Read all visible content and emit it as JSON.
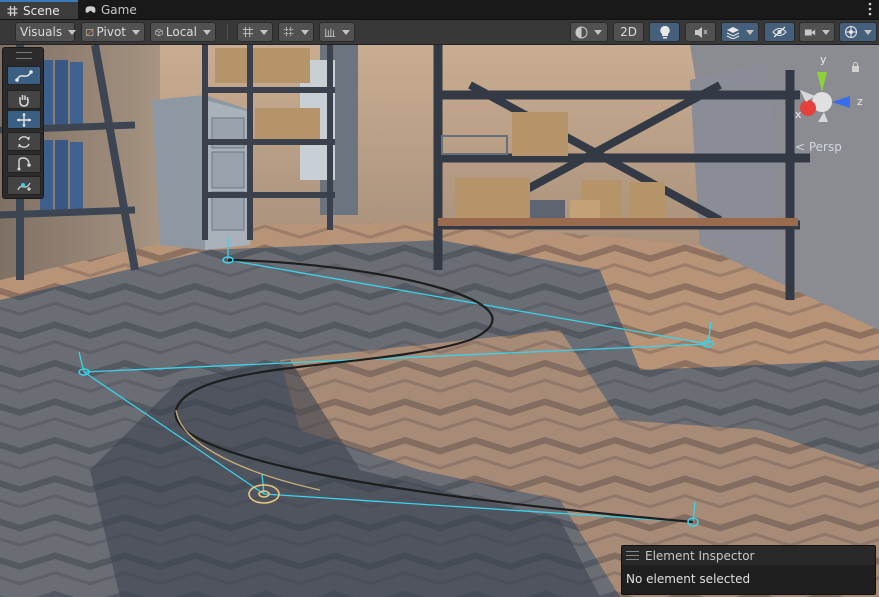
{
  "tabs": [
    {
      "label": "Scene",
      "icon": "grid-hash-icon",
      "active": true
    },
    {
      "label": "Game",
      "icon": "gamepad-icon",
      "active": false
    }
  ],
  "toolbar": {
    "visuals_label": "Visuals",
    "pivot_label": "Pivot",
    "local_label": "Local",
    "mode_2d_label": "2D"
  },
  "gizmo": {
    "projection_label": "< Persp",
    "axis_x": "x",
    "axis_y": "y",
    "axis_z": "z"
  },
  "inspector": {
    "title": "Element Inspector",
    "status": "No element selected"
  },
  "colors": {
    "spline_handle": "#3ad3ea",
    "selection": "#e6c77e",
    "active_button": "#46607c",
    "axis_x": "#e4413d",
    "axis_y": "#8fd13b",
    "axis_z": "#3a6cf0"
  }
}
